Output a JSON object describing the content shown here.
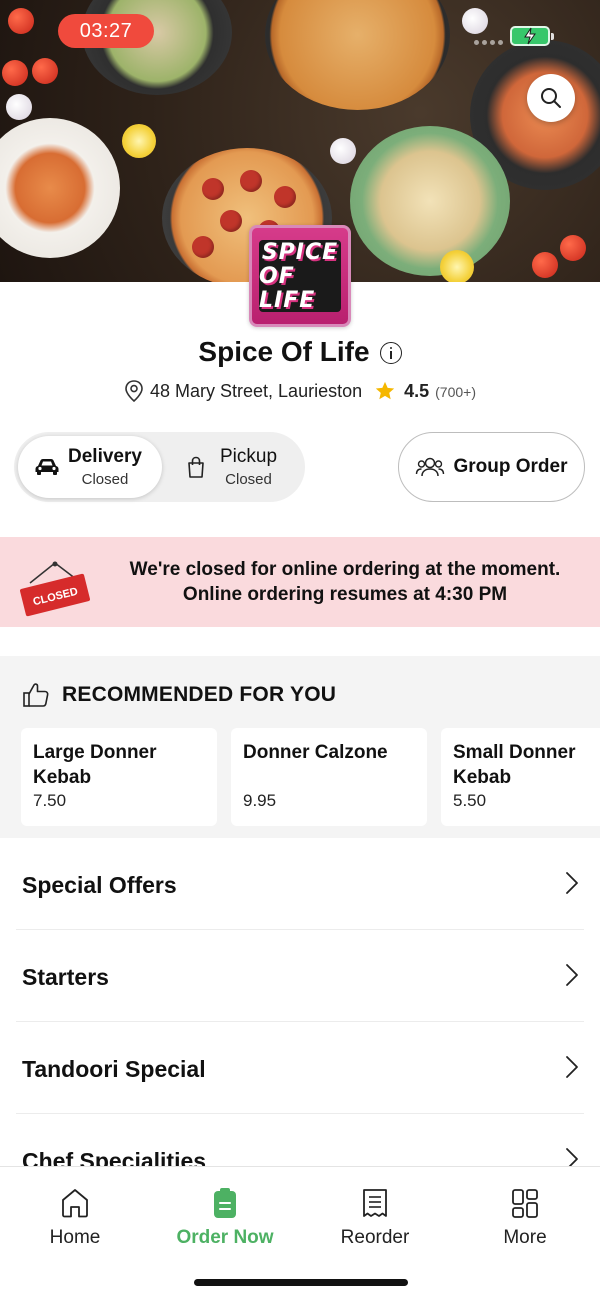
{
  "status_bar": {
    "time": "03:27"
  },
  "restaurant": {
    "logo_text_line1": "SPICE",
    "logo_text_line2": "OF LIFE",
    "name": "Spice Of Life",
    "address": "48 Mary Street, Laurieston",
    "rating": "4.5",
    "rating_count": "(700+)"
  },
  "order_mode": {
    "delivery": {
      "label": "Delivery",
      "status": "Closed",
      "selected": true
    },
    "pickup": {
      "label": "Pickup",
      "status": "Closed",
      "selected": false
    },
    "group_order_label": "Group Order"
  },
  "closed_notice": {
    "sign_text": "CLOSED",
    "line1": "We're closed for online ordering at the moment.",
    "line2": "Online ordering resumes at 4:30 PM"
  },
  "recommended": {
    "title": "RECOMMENDED FOR YOU",
    "items": [
      {
        "name": "Large Donner Kebab",
        "price": "7.50"
      },
      {
        "name": "Donner Calzone",
        "price": "9.95"
      },
      {
        "name": "Small Donner Kebab",
        "price": "5.50"
      }
    ]
  },
  "categories": [
    {
      "label": "Special Offers"
    },
    {
      "label": "Starters"
    },
    {
      "label": "Tandoori Special"
    },
    {
      "label": "Chef Specialities"
    }
  ],
  "tabbar": {
    "items": [
      {
        "label": "Home",
        "icon": "home-icon"
      },
      {
        "label": "Order Now",
        "icon": "order-icon",
        "active": true
      },
      {
        "label": "Reorder",
        "icon": "receipt-icon"
      },
      {
        "label": "More",
        "icon": "grid-icon"
      }
    ]
  },
  "colors": {
    "accent_green": "#4db163",
    "closed_banner_bg": "#fadadd",
    "time_pill": "#f04a3d",
    "rating_star": "#f5b700",
    "logo_pink": "#d63b8a"
  }
}
